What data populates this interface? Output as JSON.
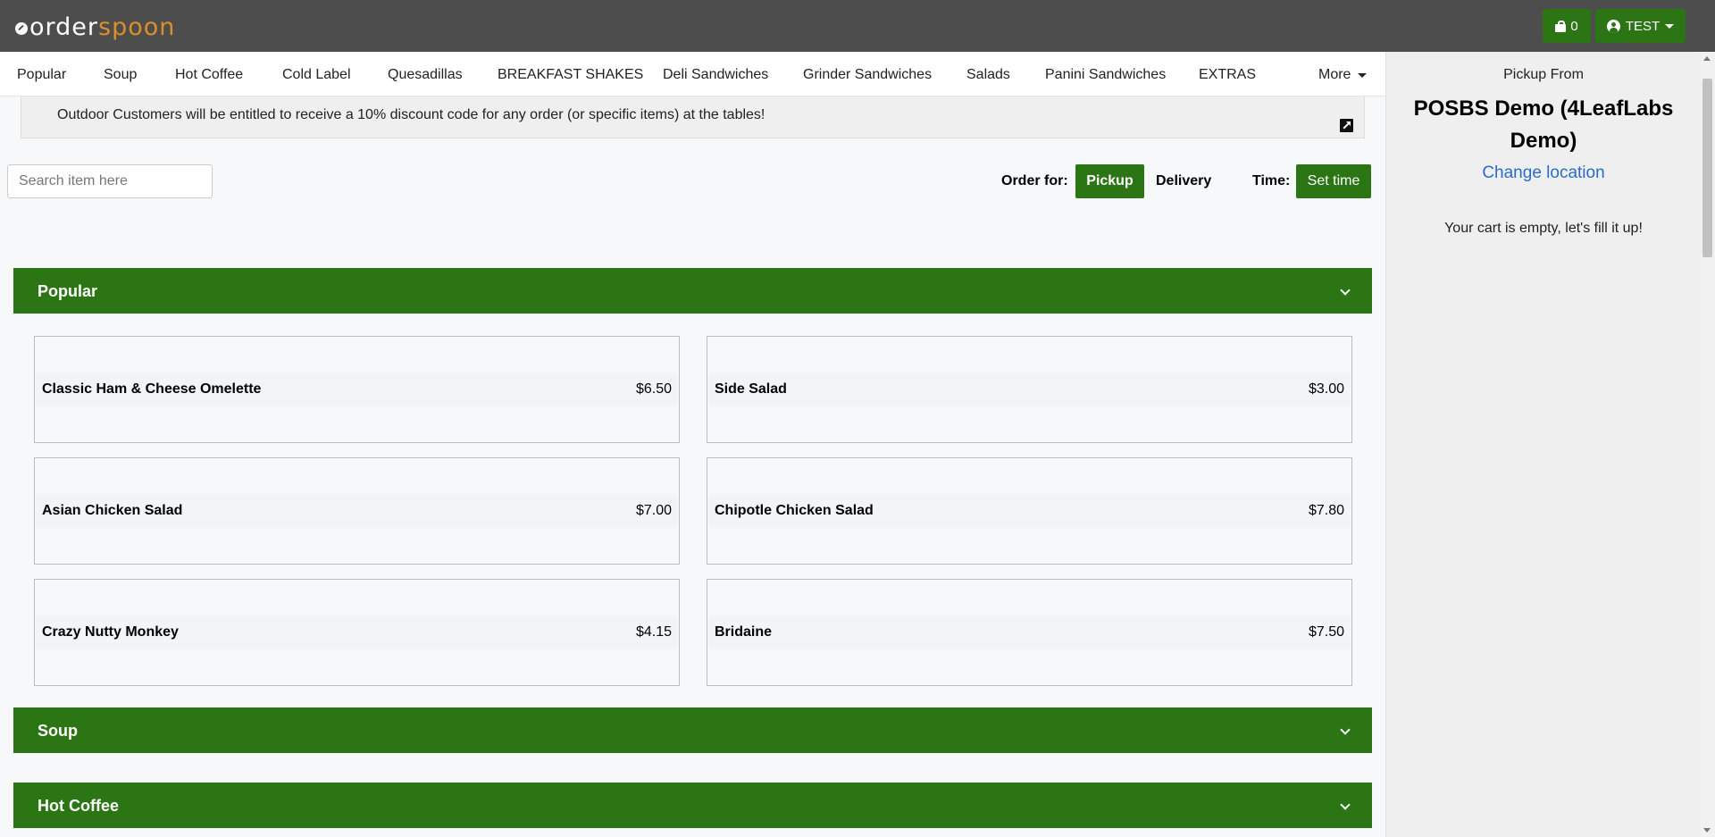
{
  "header": {
    "logo_part1": "order",
    "logo_part2": "spoon",
    "cart_count": "0",
    "user_label": "TEST",
    "brand_color": "#2b7515",
    "logo_accent": "#d9902b"
  },
  "nav": {
    "items": [
      "Popular",
      "Soup",
      "Hot Coffee",
      "Cold Label",
      "Quesadillas",
      "BREAKFAST SHAKES",
      "Deli Sandwiches",
      "Grinder Sandwiches",
      "Salads",
      "Panini Sandwiches",
      "EXTRAS"
    ],
    "more_label": "More"
  },
  "announcement": {
    "text": "Outdoor Customers will be entitled to receive a  10% discount code for any order (or specific items) at the tables!"
  },
  "search": {
    "placeholder": "Search item here"
  },
  "order_options": {
    "order_for_label": "Order for:",
    "pickup_label": "Pickup",
    "delivery_label": "Delivery",
    "time_label": "Time:",
    "set_time_label": "Set time"
  },
  "sections": [
    {
      "title": "Popular",
      "items": [
        {
          "name": "Classic Ham & Cheese Omelette",
          "price": "$6.50"
        },
        {
          "name": "Side Salad",
          "price": "$3.00"
        },
        {
          "name": "Asian Chicken Salad",
          "price": "$7.00"
        },
        {
          "name": "Chipotle Chicken Salad",
          "price": "$7.80"
        },
        {
          "name": "Crazy Nutty Monkey",
          "price": "$4.15"
        },
        {
          "name": "Bridaine",
          "price": "$7.50"
        }
      ]
    },
    {
      "title": "Soup"
    },
    {
      "title": "Hot Coffee"
    }
  ],
  "sidebar": {
    "pickup_from_label": "Pickup From",
    "location_name": "POSBS Demo (4LeafLabs Demo)",
    "change_location_label": "Change location",
    "empty_cart_text": "Your cart is empty, let's fill it up!",
    "link_color": "#2a6cc7"
  }
}
